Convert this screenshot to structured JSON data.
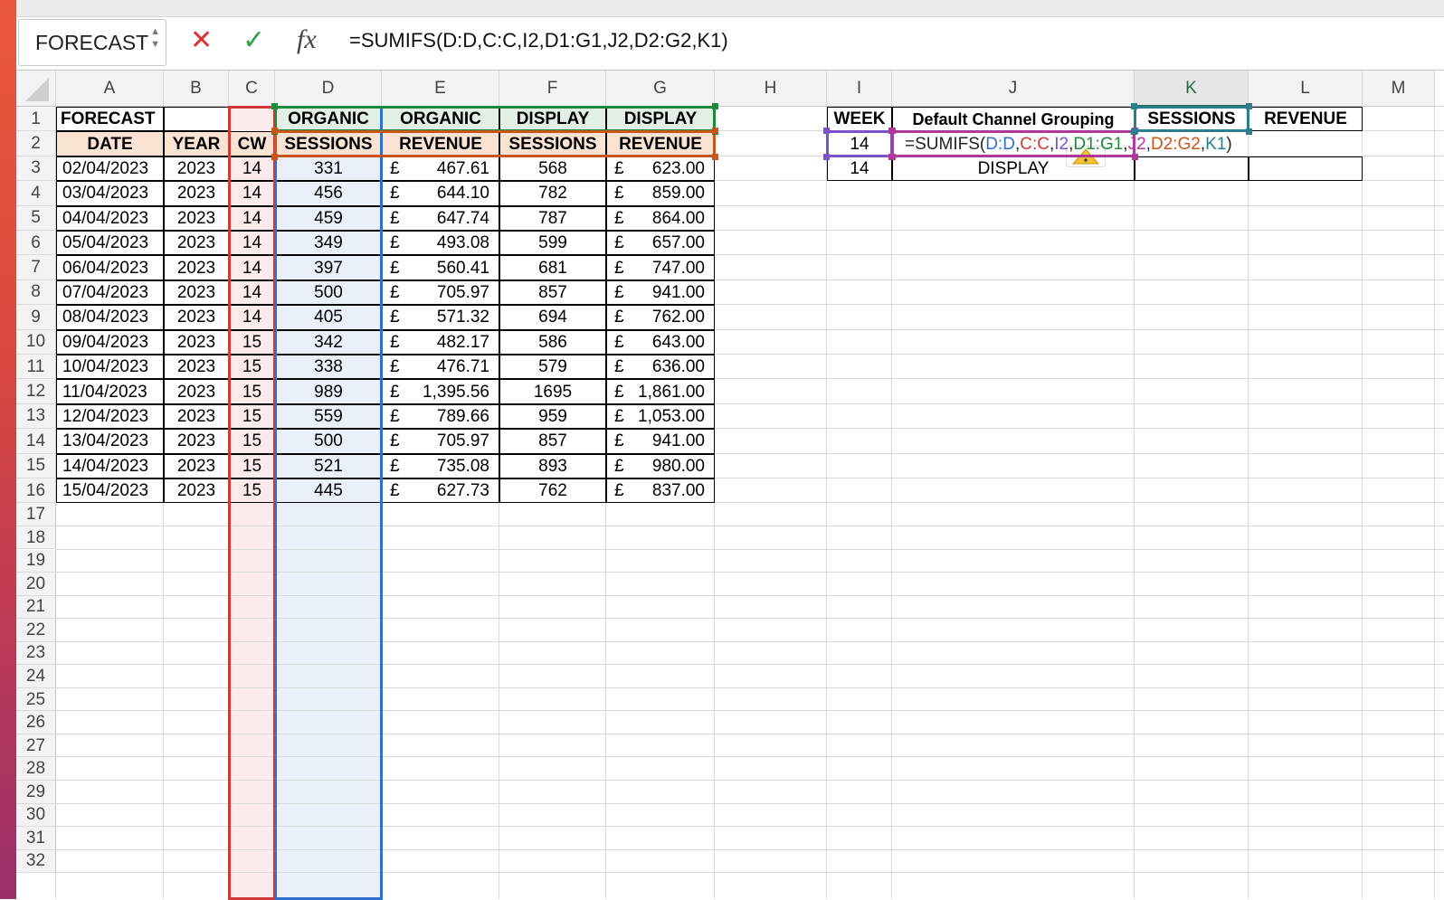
{
  "namebox": {
    "value": "FORECAST"
  },
  "formula_bar": {
    "cancel_icon": "✕",
    "enter_icon": "✓",
    "fx_label": "fx",
    "formula": "=SUMIFS(D:D,C:C,I2,D1:G1,J2,D2:G2,K1)"
  },
  "columns": [
    "A",
    "B",
    "C",
    "D",
    "E",
    "F",
    "G",
    "H",
    "I",
    "J",
    "K",
    "L",
    "M"
  ],
  "rows": [
    "1",
    "2",
    "3",
    "4",
    "5",
    "6",
    "7",
    "8",
    "9",
    "10",
    "11",
    "12",
    "13",
    "14",
    "15",
    "16",
    "17",
    "18",
    "19",
    "20",
    "21",
    "22",
    "23",
    "24",
    "25",
    "26",
    "27",
    "28",
    "29",
    "30",
    "31",
    "32"
  ],
  "sheet": {
    "row1": [
      "FORECAST",
      "",
      "",
      "ORGANIC",
      "ORGANIC",
      "DISPLAY",
      "DISPLAY"
    ],
    "row2": [
      "DATE",
      "YEAR",
      "CW",
      "SESSIONS",
      "REVENUE",
      "SESSIONS",
      "REVENUE"
    ],
    "data": [
      [
        "02/04/2023",
        "2023",
        "14",
        "331",
        "£",
        "467.61",
        "568",
        "£",
        "623.00"
      ],
      [
        "03/04/2023",
        "2023",
        "14",
        "456",
        "£",
        "644.10",
        "782",
        "£",
        "859.00"
      ],
      [
        "04/04/2023",
        "2023",
        "14",
        "459",
        "£",
        "647.74",
        "787",
        "£",
        "864.00"
      ],
      [
        "05/04/2023",
        "2023",
        "14",
        "349",
        "£",
        "493.08",
        "599",
        "£",
        "657.00"
      ],
      [
        "06/04/2023",
        "2023",
        "14",
        "397",
        "£",
        "560.41",
        "681",
        "£",
        "747.00"
      ],
      [
        "07/04/2023",
        "2023",
        "14",
        "500",
        "£",
        "705.97",
        "857",
        "£",
        "941.00"
      ],
      [
        "08/04/2023",
        "2023",
        "14",
        "405",
        "£",
        "571.32",
        "694",
        "£",
        "762.00"
      ],
      [
        "09/04/2023",
        "2023",
        "15",
        "342",
        "£",
        "482.17",
        "586",
        "£",
        "643.00"
      ],
      [
        "10/04/2023",
        "2023",
        "15",
        "338",
        "£",
        "476.71",
        "579",
        "£",
        "636.00"
      ],
      [
        "11/04/2023",
        "2023",
        "15",
        "989",
        "£",
        "1,395.56",
        "1695",
        "£",
        "1,861.00"
      ],
      [
        "12/04/2023",
        "2023",
        "15",
        "559",
        "£",
        "789.66",
        "959",
        "£",
        "1,053.00"
      ],
      [
        "13/04/2023",
        "2023",
        "15",
        "500",
        "£",
        "705.97",
        "857",
        "£",
        "941.00"
      ],
      [
        "14/04/2023",
        "2023",
        "15",
        "521",
        "£",
        "735.08",
        "893",
        "£",
        "980.00"
      ],
      [
        "15/04/2023",
        "2023",
        "15",
        "445",
        "£",
        "627.73",
        "762",
        "£",
        "837.00"
      ]
    ]
  },
  "summary": {
    "headers": [
      "WEEK",
      "Default Channel Grouping",
      "SESSIONS",
      "REVENUE"
    ],
    "row2_week": "14",
    "editing_formula_parts": [
      {
        "t": "=SUMIFS(",
        "c": "#222"
      },
      {
        "t": "D:D",
        "c": "#2f6fd0"
      },
      {
        "t": ",",
        "c": "#222"
      },
      {
        "t": "C:C",
        "c": "#d23a3a"
      },
      {
        "t": ",",
        "c": "#222"
      },
      {
        "t": "I2",
        "c": "#7b52c7"
      },
      {
        "t": ",",
        "c": "#222"
      },
      {
        "t": "D1:G1",
        "c": "#1f8a3a"
      },
      {
        "t": ",",
        "c": "#222"
      },
      {
        "t": "J2",
        "c": "#b0389b"
      },
      {
        "t": ",",
        "c": "#222"
      },
      {
        "t": "D2:G2",
        "c": "#c8561a"
      },
      {
        "t": ",",
        "c": "#222"
      },
      {
        "t": "K1",
        "c": "#2b7d8f"
      },
      {
        "t": ")",
        "c": "#222"
      }
    ],
    "row3_week": "14",
    "row3_channel": "DISPLAY"
  },
  "ref_colors": {
    "D": "#2f6fd0",
    "C": "#d23a3a",
    "I2": "#7b52c7",
    "D1G1": "#1f8a3a",
    "J2": "#b0389b",
    "D2G2": "#c8561a",
    "K1": "#2b7d8f"
  }
}
